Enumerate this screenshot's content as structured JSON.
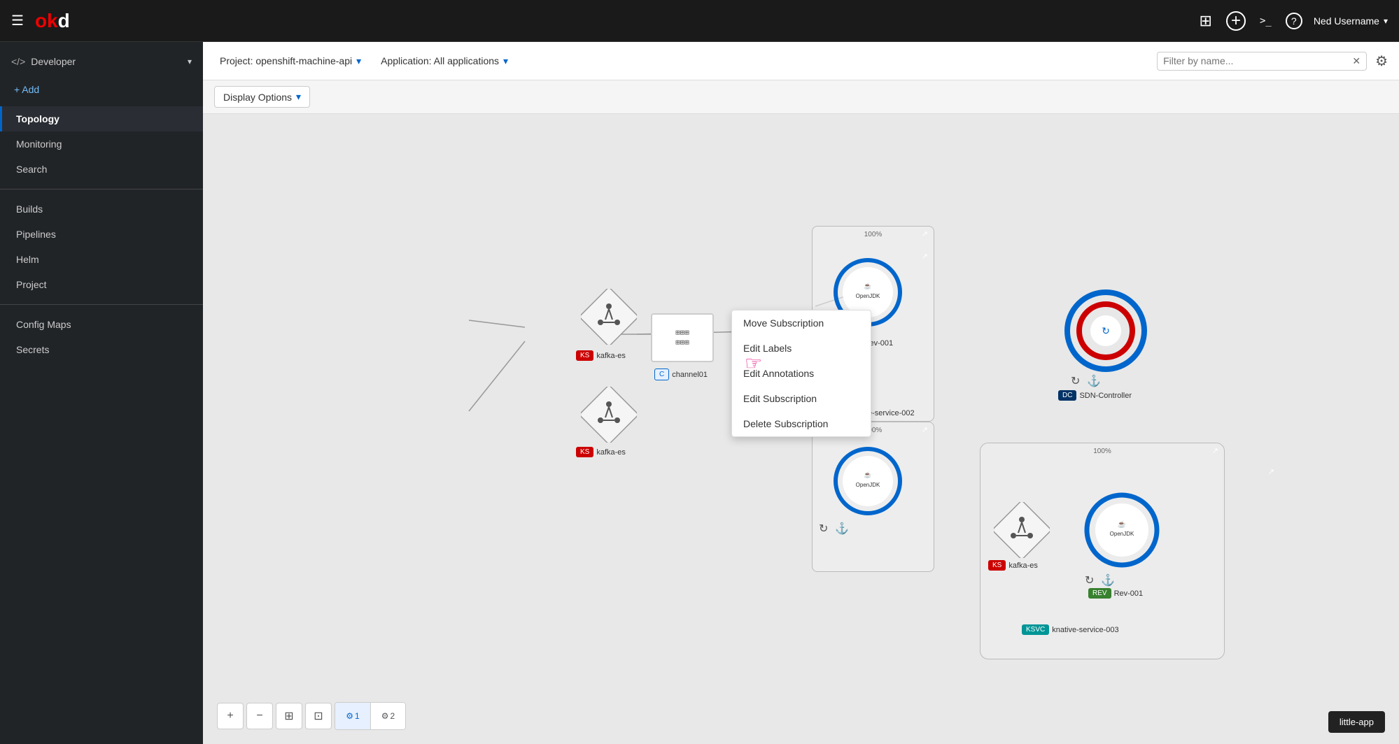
{
  "topnav": {
    "hamburger_label": "☰",
    "logo_red": "ok",
    "logo_white": "d",
    "icons": {
      "grid": "⊞",
      "add": "+",
      "terminal": ">_",
      "help": "?"
    },
    "user": {
      "name": "Ned Username",
      "caret": "▾"
    }
  },
  "sidebar": {
    "developer_label": "Developer",
    "developer_icon": "</>",
    "add_label": "+ Add",
    "items": [
      {
        "id": "topology",
        "label": "Topology",
        "active": true
      },
      {
        "id": "monitoring",
        "label": "Monitoring",
        "active": false
      },
      {
        "id": "search",
        "label": "Search",
        "active": false
      },
      {
        "id": "builds",
        "label": "Builds",
        "active": false
      },
      {
        "id": "pipelines",
        "label": "Pipelines",
        "active": false
      },
      {
        "id": "helm",
        "label": "Helm",
        "active": false
      },
      {
        "id": "project",
        "label": "Project",
        "active": false
      },
      {
        "id": "configmaps",
        "label": "Config Maps",
        "active": false
      },
      {
        "id": "secrets",
        "label": "Secrets",
        "active": false
      }
    ]
  },
  "toolbar": {
    "project_label": "Project: openshift-machine-api",
    "project_caret": "▾",
    "application_label": "Application: All applications",
    "application_caret": "▾",
    "filter_placeholder": "Filter by name...",
    "filter_clear": "✕",
    "settings_icon": "⚙"
  },
  "toolbar2": {
    "display_options_label": "Display Options",
    "display_options_caret": "▾"
  },
  "context_menu": {
    "items": [
      "Move Subscription",
      "Edit Labels",
      "Edit Annotations",
      "Edit Subscription",
      "Delete Subscription"
    ]
  },
  "bottom_toolbar": {
    "zoom_in": "+",
    "zoom_out": "−",
    "fit": "⊞",
    "reset": "⊡",
    "node1_icon": "⚙",
    "node1_label": "1",
    "node2_icon": "⚙",
    "node2_label": "2"
  },
  "nodes": {
    "kafka_nodes": [
      {
        "id": "kafka1",
        "label_type": "KS",
        "label_text": "kafka-es"
      },
      {
        "id": "kafka2",
        "label_type": "KS",
        "label_text": "kafka-es"
      },
      {
        "id": "kafka3",
        "label_type": "KS",
        "label_text": "kafka-es"
      }
    ],
    "channel_label": "channel01",
    "sdn_controller_label": "SDN-Controller",
    "knative_service_002": "knative-service-002",
    "knative_service_003": "knative-service-003",
    "rev_001_labels": [
      "Rev-001",
      "Rev-001"
    ],
    "pct": "100%"
  },
  "little_app": {
    "label": "little-app"
  }
}
